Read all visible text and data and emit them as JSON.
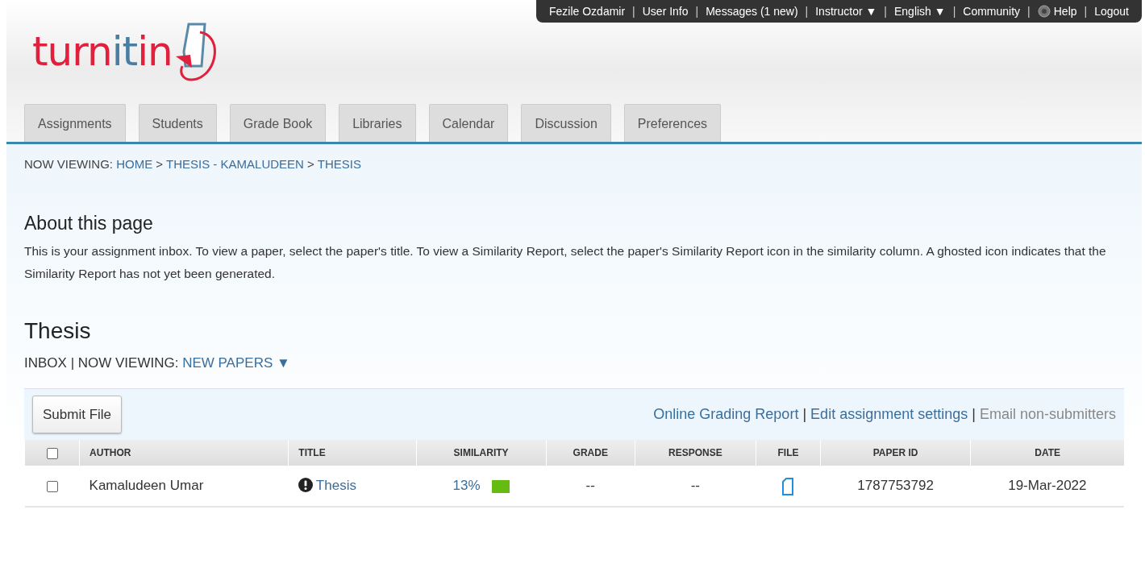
{
  "top_bar": {
    "separator": "|",
    "items": [
      {
        "label": "Fezile Ozdamir",
        "kind": "text"
      },
      {
        "label": "User Info",
        "kind": "link"
      },
      {
        "label": "Messages (1 new)",
        "kind": "link"
      },
      {
        "label": "Instructor ▼",
        "kind": "link"
      },
      {
        "label": "English ▼",
        "kind": "link"
      },
      {
        "label": "Community",
        "kind": "link"
      },
      {
        "label": "Help",
        "kind": "help"
      },
      {
        "label": "Logout",
        "kind": "link"
      }
    ]
  },
  "logo": {
    "parts": [
      {
        "text": "turn",
        "color": "#e0203c"
      },
      {
        "text": "it",
        "color": "#4a7ea0"
      },
      {
        "text": "in",
        "color": "#e0203c"
      }
    ]
  },
  "tabs": [
    {
      "label": "Assignments",
      "selected": false
    },
    {
      "label": "Students",
      "selected": false
    },
    {
      "label": "Grade Book",
      "selected": false
    },
    {
      "label": "Libraries",
      "selected": false
    },
    {
      "label": "Calendar",
      "selected": false
    },
    {
      "label": "Discussion",
      "selected": false
    },
    {
      "label": "Preferences",
      "selected": false
    }
  ],
  "breadcrumb": {
    "prefix": "NOW VIEWING:",
    "separator": ">",
    "links": [
      "HOME",
      "THESIS - KAMALUDEEN",
      "THESIS"
    ]
  },
  "about": {
    "title": "About this page",
    "text": "This is your assignment inbox. To view a paper, select the paper's title. To view a Similarity Report, select the paper's Similarity Report icon in the similarity column. A ghosted icon indicates that the Similarity Report has not yet been generated."
  },
  "assignment": {
    "title": "Thesis",
    "inbox": "INBOX",
    "viewing_label": "| NOW VIEWING:",
    "viewing_value": "NEW PAPERS ▼"
  },
  "toolbar": {
    "submit": "Submit File",
    "separator": "|",
    "links": [
      {
        "label": "Online Grading Report",
        "disabled": false
      },
      {
        "label": "Edit assignment settings",
        "disabled": false
      },
      {
        "label": "Email non-submitters",
        "disabled": true
      }
    ]
  },
  "table": {
    "columns": [
      "AUTHOR",
      "TITLE",
      "SIMILARITY",
      "GRADE",
      "RESPONSE",
      "FILE",
      "PAPER ID",
      "DATE"
    ],
    "select_all_checked": false,
    "rows": [
      {
        "checked": false,
        "author": "Kamaludeen Umar",
        "title": "Thesis",
        "similarity": "13%",
        "color": "#66bb11",
        "grade": "--",
        "response": "--",
        "paper_id": "1787753792",
        "date": "19-Mar-2022"
      }
    ]
  }
}
